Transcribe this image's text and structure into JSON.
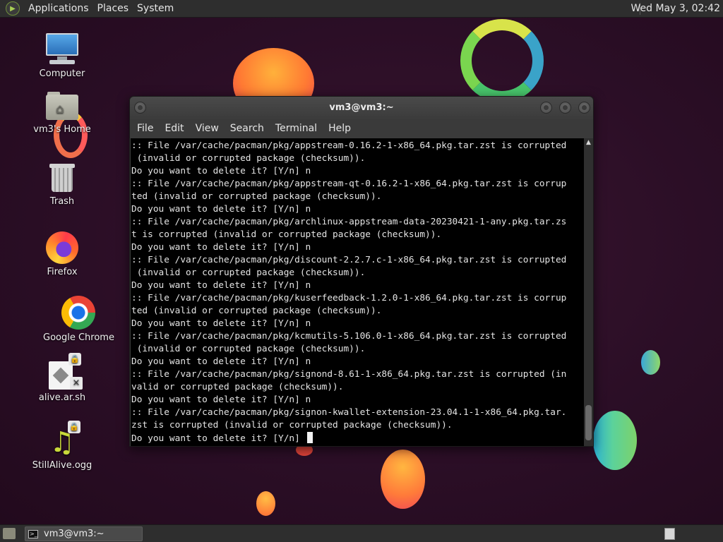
{
  "top_panel": {
    "menus": [
      "Applications",
      "Places",
      "System"
    ],
    "clock": "Wed May  3, 02:42",
    "apps_icon": "gnome-foot-icon"
  },
  "desktop_icons": [
    {
      "label": "Computer",
      "icon": "computer-icon"
    },
    {
      "label": "vm3's Home",
      "icon": "home-folder-icon"
    },
    {
      "label": "Trash",
      "icon": "trash-icon"
    },
    {
      "label": "Firefox",
      "icon": "firefox-icon"
    },
    {
      "label": "Google Chrome",
      "icon": "chrome-icon"
    },
    {
      "label": "alive.ar.sh",
      "icon": "script-file-icon"
    },
    {
      "label": "StillAlive.ogg",
      "icon": "audio-file-icon"
    }
  ],
  "terminal": {
    "title": "vm3@vm3:~",
    "menu": [
      "File",
      "Edit",
      "View",
      "Search",
      "Terminal",
      "Help"
    ],
    "lines": [
      ":: File /var/cache/pacman/pkg/appstream-0.16.2-1-x86_64.pkg.tar.zst is corrupted",
      " (invalid or corrupted package (checksum)).",
      "Do you want to delete it? [Y/n] n",
      ":: File /var/cache/pacman/pkg/appstream-qt-0.16.2-1-x86_64.pkg.tar.zst is corrup",
      "ted (invalid or corrupted package (checksum)).",
      "Do you want to delete it? [Y/n] n",
      ":: File /var/cache/pacman/pkg/archlinux-appstream-data-20230421-1-any.pkg.tar.zs",
      "t is corrupted (invalid or corrupted package (checksum)).",
      "Do you want to delete it? [Y/n] n",
      ":: File /var/cache/pacman/pkg/discount-2.2.7.c-1-x86_64.pkg.tar.zst is corrupted",
      " (invalid or corrupted package (checksum)).",
      "Do you want to delete it? [Y/n] n",
      ":: File /var/cache/pacman/pkg/kuserfeedback-1.2.0-1-x86_64.pkg.tar.zst is corrup",
      "ted (invalid or corrupted package (checksum)).",
      "Do you want to delete it? [Y/n] n",
      ":: File /var/cache/pacman/pkg/kcmutils-5.106.0-1-x86_64.pkg.tar.zst is corrupted",
      " (invalid or corrupted package (checksum)).",
      "Do you want to delete it? [Y/n] n",
      ":: File /var/cache/pacman/pkg/signond-8.61-1-x86_64.pkg.tar.zst is corrupted (in",
      "valid or corrupted package (checksum)).",
      "Do you want to delete it? [Y/n] n",
      ":: File /var/cache/pacman/pkg/signon-kwallet-extension-23.04.1-1-x86_64.pkg.tar.",
      "zst is corrupted (invalid or corrupted package (checksum)).",
      "Do you want to delete it? [Y/n] "
    ]
  },
  "taskbar": {
    "task_label": "vm3@vm3:~"
  }
}
